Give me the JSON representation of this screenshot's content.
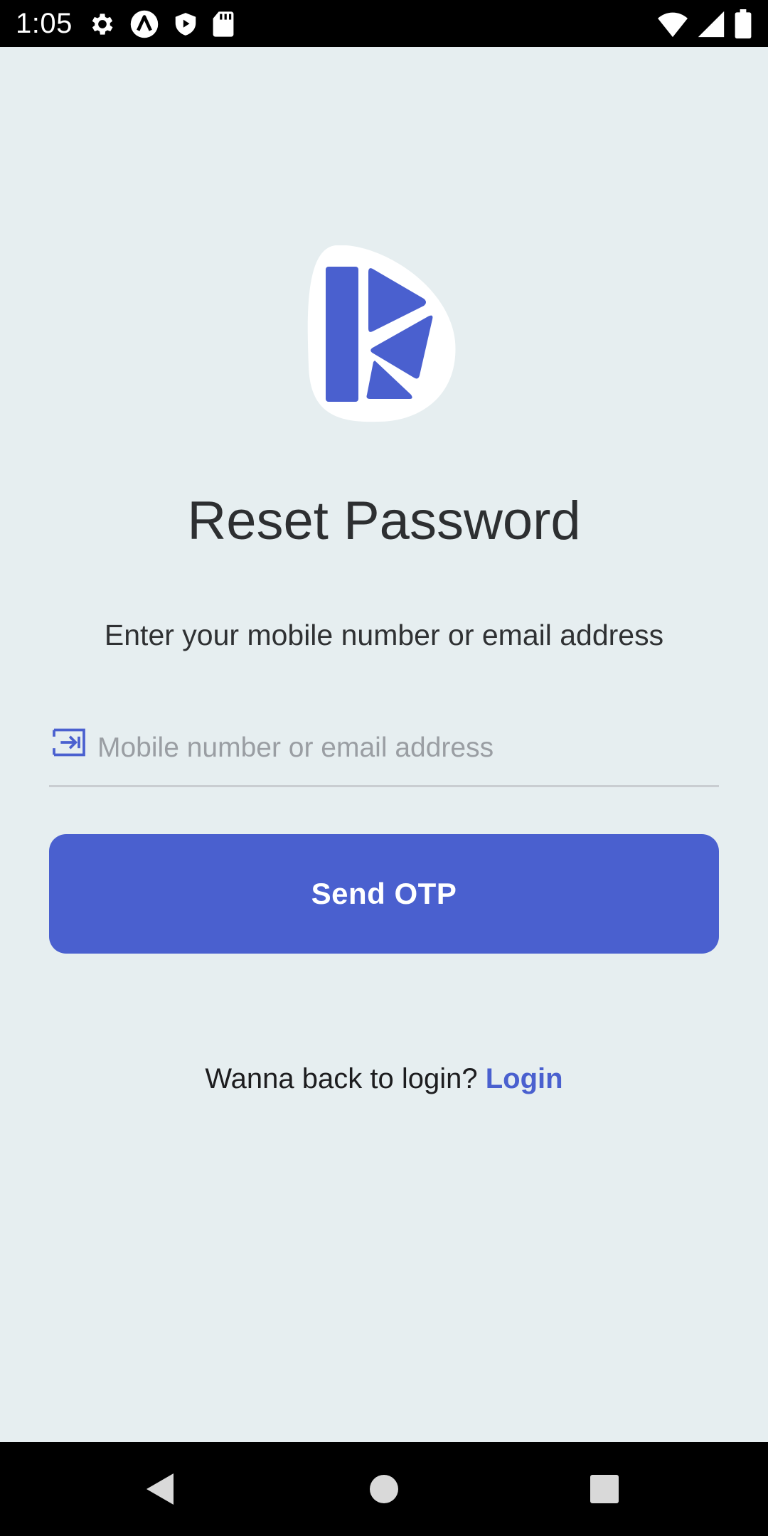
{
  "status_bar": {
    "time": "1:05",
    "left_icons": [
      "settings-icon",
      "app-a-icon",
      "shield-play-icon",
      "sd-card-icon"
    ],
    "right_icons": [
      "wifi-icon",
      "signal-icon",
      "battery-icon"
    ]
  },
  "logo": {
    "icon": "app-logo-icon",
    "accent_color": "#4a60cf"
  },
  "page": {
    "title": "Reset Password",
    "subtitle": "Enter your mobile number or email address"
  },
  "form": {
    "input_icon": "login-arrow-icon",
    "input_value": "",
    "input_placeholder": "Mobile number or email address",
    "submit_label": "Send OTP"
  },
  "footer": {
    "prompt": "Wanna back to login? ",
    "link_label": "Login"
  },
  "nav_bar": {
    "buttons": [
      "back-icon",
      "home-icon",
      "recents-icon"
    ]
  },
  "colors": {
    "background": "#e6eef0",
    "accent": "#4a60cf",
    "title_text": "#2d2f31",
    "placeholder_text": "#9a9ea3"
  }
}
